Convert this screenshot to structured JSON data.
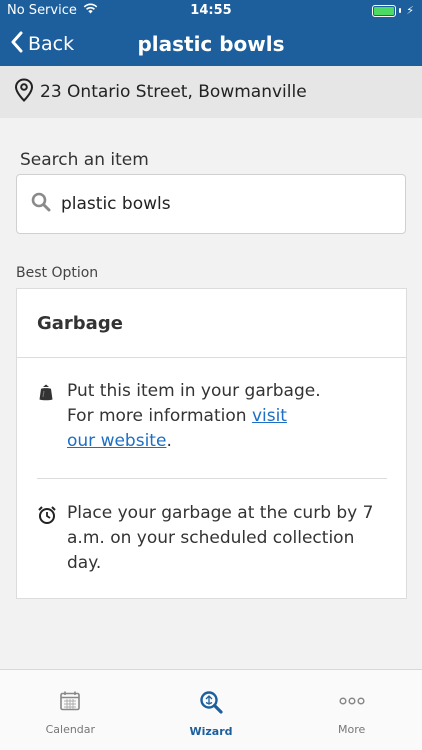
{
  "status_bar": {
    "carrier": "No Service",
    "time": "14:55",
    "battery_level": 1.0
  },
  "nav": {
    "back_label": "Back",
    "title": "plastic bowls"
  },
  "address": {
    "text": "23 Ontario Street, Bowmanville",
    "icon": "location-pin-icon"
  },
  "search": {
    "label": "Search an item",
    "value": "plastic bowls",
    "icon": "search-icon"
  },
  "result": {
    "section_label": "Best Option",
    "title": "Garbage",
    "instruction": {
      "line1": "Put this item in your garbage.",
      "line2_prefix": "For more information ",
      "link1": "visit",
      "link2": "our website",
      "suffix": ".",
      "icon": "garbage-bag-icon"
    },
    "schedule": {
      "text": "Place your garbage at the curb by 7 a.m. on your scheduled collection day.",
      "icon": "alarm-clock-icon"
    }
  },
  "tabs": [
    {
      "label": "Calendar",
      "icon": "calendar-icon",
      "active": false
    },
    {
      "label": "Wizard",
      "icon": "wizard-search-icon",
      "active": true
    },
    {
      "label": "More",
      "icon": "more-dots-icon",
      "active": false
    }
  ],
  "colors": {
    "brand": "#1c5f9c",
    "link": "#1c6fc4",
    "battery": "#4cd964"
  }
}
